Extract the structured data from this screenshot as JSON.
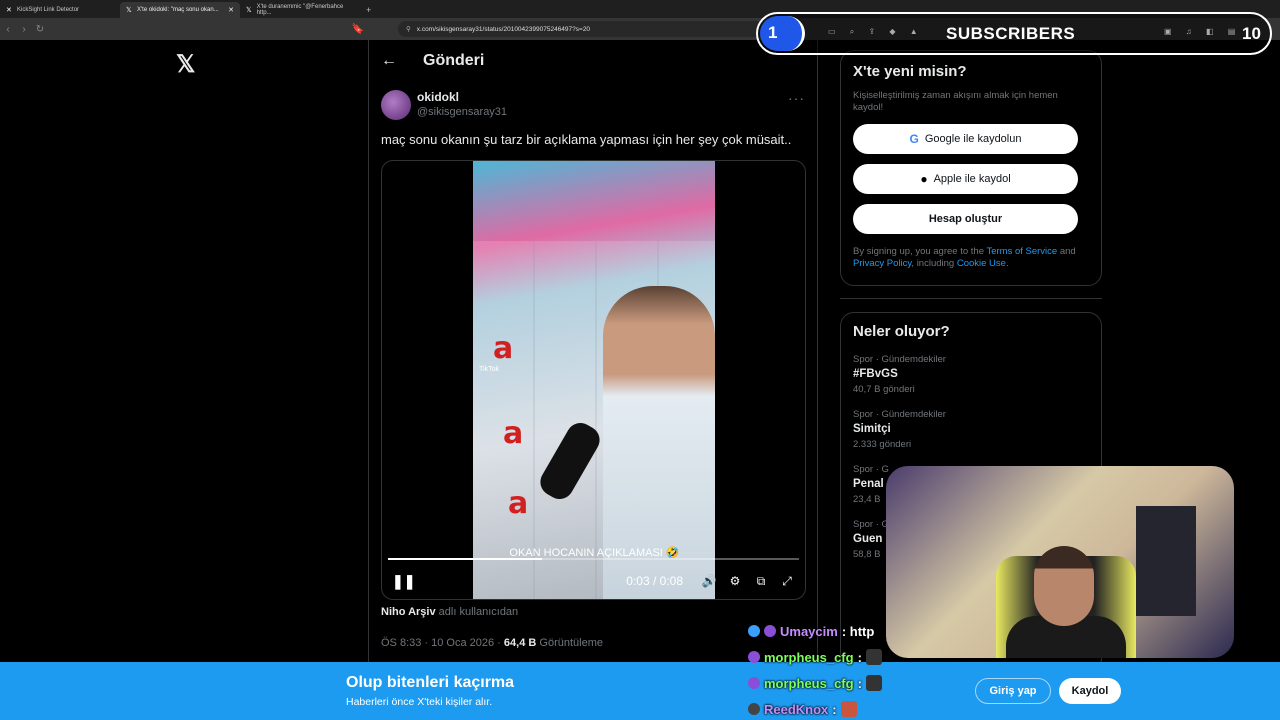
{
  "browser": {
    "tabs": [
      {
        "label": "KickSight Link Detector",
        "active": false
      },
      {
        "label": "X'te okidokl: \"maç sonu okan...",
        "active": true
      },
      {
        "label": "X'te duranemmic \"@Fenerbahce http...",
        "active": false
      }
    ],
    "new_tab": "+",
    "url": "x.com/sikisgensaray31/status/2010042399075246497?s=20"
  },
  "left": {
    "logo": "𝕏"
  },
  "post": {
    "header_title": "Gönderi",
    "display_name": "okidokl",
    "handle": "@sikisgensaray31",
    "more": "···",
    "text": "maç sonu okanın şu tarz bir açıklama yapması için her şey çok müsait..",
    "video": {
      "caption": "OKAN HOCANIN AÇIKLAMASI 🤣",
      "time": "0:03 / 0:08",
      "progress": 0.375,
      "watermark": "TikTok"
    },
    "source_name": "Niho Arşiv",
    "source_suffix": "adlı kullanıcıdan",
    "timestamp": "ÖS 8:33 · 10 Oca 2026 ·",
    "views": "64,4 B",
    "views_label": "Görüntüleme"
  },
  "signup_card": {
    "title": "X'te yeni misin?",
    "subtitle": "Kişiselleştirilmiş zaman akışını almak için hemen kaydol!",
    "google_btn": "Google ile kaydolun",
    "apple_btn": "Apple ile kaydol",
    "create_btn": "Hesap oluştur",
    "terms_prefix": "By signing up, you agree to the",
    "terms_link": "Terms of Service",
    "terms_and": "and",
    "privacy_link": "Privacy Policy",
    "terms_including": ", including",
    "cookie_link": "Cookie Use."
  },
  "trends": {
    "title": "Neler oluyor?",
    "items": [
      {
        "category": "Spor · Gündemdekiler",
        "name": "#FBvGS",
        "count": "40,7 B gönderi"
      },
      {
        "category": "Spor · Gündemdekiler",
        "name": "Simitçi",
        "count": "2.333 gönderi"
      },
      {
        "category": "Spor · G",
        "name": "Penal",
        "count": "23,4 B"
      },
      {
        "category": "Spor · G",
        "name": "Guen",
        "count": "58,8 B"
      }
    ]
  },
  "banner": {
    "title": "Olup bitenleri kaçırma",
    "subtitle": "Haberleri önce X'teki kişiler alır.",
    "login_btn": "Giriş yap",
    "signup_btn": "Kaydol"
  },
  "overlay": {
    "subs_goal_current": "1",
    "subs_label": "SUBSCRIBERS",
    "subs_goal_target": "10",
    "chat": [
      {
        "user": "Umaycim",
        "msg": ": http",
        "color": "#c58cff"
      },
      {
        "user": "morpheus_cfg",
        "msg": ":",
        "color": "#7cff5a"
      },
      {
        "user": "morpheus_cfg",
        "msg": ":",
        "color": "#7cff5a"
      },
      {
        "user": "ReedKnox",
        "msg": ":",
        "color": "#c58cff"
      }
    ]
  },
  "colors": {
    "accent": "#1d9bf0",
    "background": "#000000",
    "subs_blue": "#1f58e8"
  }
}
